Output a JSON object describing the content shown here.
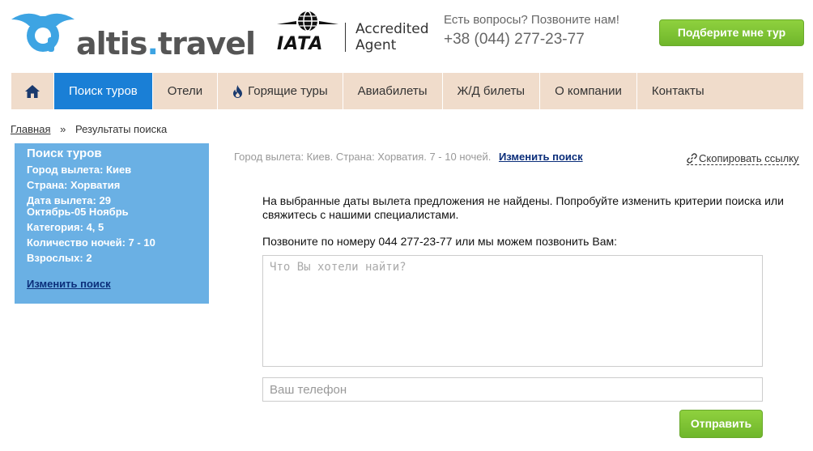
{
  "header": {
    "logo_text_main": "altis",
    "logo_text_dot": ".",
    "logo_text_end": "travel",
    "iata_word": "IATA",
    "iata_accredited": "Accredited",
    "iata_agent": "Agent",
    "contact_question": "Есть вопросы? Позвоните нам!",
    "contact_phone": "+38 (044) 277-23-77",
    "cta_label": "Подберите мне тур",
    "colors": {
      "brand_blue": "#3da4e3",
      "cta_green": "#7cc234"
    }
  },
  "nav": {
    "home_icon": "home-icon",
    "items": [
      {
        "label": "Поиск туров",
        "active": true
      },
      {
        "label": "Отели",
        "active": false
      },
      {
        "label": "Горящие туры",
        "active": false,
        "icon": "fire-icon"
      },
      {
        "label": "Авиабилеты",
        "active": false
      },
      {
        "label": "Ж/Д билеты",
        "active": false
      },
      {
        "label": "О компании",
        "active": false
      },
      {
        "label": "Контакты",
        "active": false
      }
    ],
    "colors": {
      "bar": "#f0dccb",
      "active": "#1a7fd6"
    }
  },
  "breadcrumb": {
    "home": "Главная",
    "separator": "»",
    "current": "Результаты поиска"
  },
  "sidebar": {
    "title": "Поиск туров",
    "rows": [
      "Город вылета: Киев",
      "Страна: Хорватия",
      "Дата вылета: 29 Октябрь-05 Ноябрь",
      "Категория: 4, 5",
      "Количество ночей: 7 - 10",
      "Взрослых: 2"
    ],
    "change_link": "Изменить поиск",
    "color": "#6ab0e4"
  },
  "main": {
    "summary": "Город вылета: Киев.  Страна: Хорватия.   7 - 10 ночей.",
    "change_search": "Изменить поиск",
    "copy_link": "Скопировать ссылку",
    "message": "На выбранные даты вылета предложения не найдены. Попробуйте изменить критерии поиска или свяжитесь с нашими специалистами.",
    "call_line": "Позвоните по номеру 044 277-23-77 или мы можем позвонить Вам:",
    "textarea_placeholder": "Что Вы хотели найти?",
    "phone_placeholder": "Ваш телефон",
    "submit_label": "Отправить"
  }
}
